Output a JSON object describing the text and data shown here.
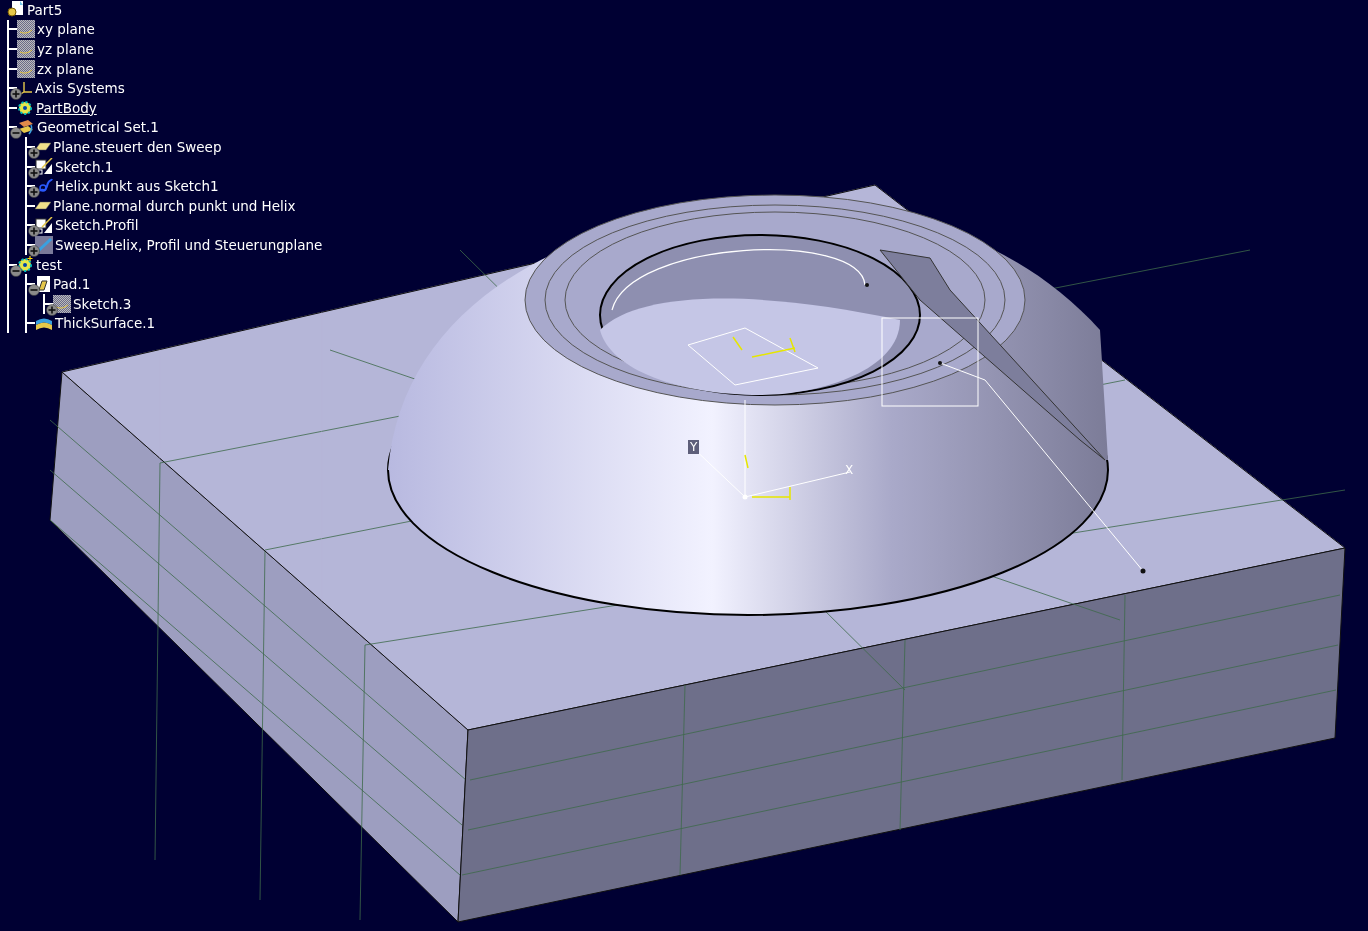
{
  "tree": {
    "label": "Part5",
    "kind": "part",
    "current": false,
    "children": [
      {
        "label": "xy plane",
        "kind": "plane-ref",
        "current": false
      },
      {
        "label": "yz plane",
        "kind": "plane-ref",
        "current": false
      },
      {
        "label": "zx plane",
        "kind": "plane-ref",
        "current": false
      },
      {
        "label": "Axis Systems",
        "kind": "axis",
        "expanded": false,
        "current": false
      },
      {
        "label": "PartBody",
        "kind": "body",
        "current": true
      },
      {
        "label": "Geometrical Set.1",
        "kind": "geoset",
        "expanded": true,
        "current": false,
        "children": [
          {
            "label": "Plane.steuert den Sweep",
            "kind": "plane",
            "expanded": false,
            "current": false
          },
          {
            "label": "Sketch.1",
            "kind": "sketch",
            "expanded": false,
            "current": false
          },
          {
            "label": "Helix.punkt aus Sketch1",
            "kind": "helix",
            "expanded": false,
            "current": false
          },
          {
            "label": "Plane.normal durch punkt und Helix",
            "kind": "plane",
            "current": false
          },
          {
            "label": "Sketch.Profil",
            "kind": "sketch",
            "expanded": false,
            "current": false
          },
          {
            "label": "Sweep.Helix, Profil und Steuerungplane",
            "kind": "sweep",
            "expanded": false,
            "current": false
          }
        ]
      },
      {
        "label": "test",
        "kind": "body-new",
        "expanded": true,
        "current": false,
        "children": [
          {
            "label": "Pad.1",
            "kind": "pad",
            "expanded": true,
            "current": false,
            "children": [
              {
                "label": "Sketch.3",
                "kind": "plane-ref",
                "expanded": false,
                "current": false
              }
            ]
          },
          {
            "label": "ThickSurface.1",
            "kind": "thick",
            "current": false
          }
        ]
      }
    ]
  },
  "viewport": {
    "axis_labels": [
      "X",
      "Y"
    ]
  }
}
